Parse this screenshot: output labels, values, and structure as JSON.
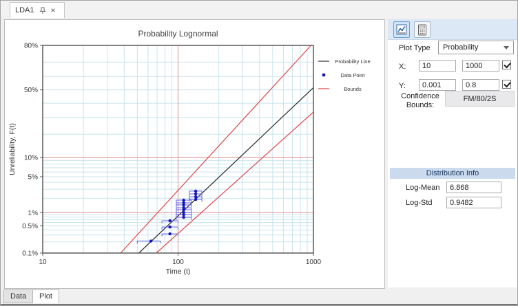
{
  "icons": {
    "close": "×"
  },
  "doc_tab": {
    "title": "LDA1"
  },
  "sidebar": {
    "plot_type": {
      "label": "Plot Type",
      "value": "Probability"
    },
    "x_range": {
      "label": "X:",
      "min": "10",
      "max": "1000",
      "checked": true
    },
    "y_range": {
      "label": "Y:",
      "min": "0.001",
      "max": "0.8",
      "checked": true
    },
    "confidence_bounds": {
      "label": "Confidence Bounds:",
      "value": "FM/80/2S"
    },
    "distribution_info": {
      "header": "Distribution Info",
      "fields": [
        {
          "label": "Log-Mean",
          "value": "6.868"
        },
        {
          "label": "Log-Std",
          "value": "0.9482"
        }
      ]
    }
  },
  "bottom_tabs": [
    {
      "label": "Data",
      "active": false
    },
    {
      "label": "Plot",
      "active": true
    }
  ],
  "chart_data": {
    "type": "line",
    "title": "Probability Lognormal",
    "xlabel": "Time (t)",
    "ylabel": "Unreliability, F(t)",
    "x_scale": "log10",
    "y_scale": "normal-probit",
    "xlim": [
      10,
      1000
    ],
    "ylim_pct": [
      0.1,
      80
    ],
    "x_ticks": [
      {
        "t": 10,
        "label": "10"
      },
      {
        "t": 100,
        "label": "100"
      },
      {
        "t": 1000,
        "label": "1000"
      }
    ],
    "y_ticks": [
      {
        "pct": 80,
        "label": "80%"
      },
      {
        "pct": 50,
        "label": "50%"
      },
      {
        "pct": 10,
        "label": "10%"
      },
      {
        "pct": 5,
        "label": "5%"
      },
      {
        "pct": 1,
        "label": "1%"
      },
      {
        "pct": 0.5,
        "label": "0.5%"
      },
      {
        "pct": 0.1,
        "label": "0.1%"
      }
    ],
    "x_major": [
      100
    ],
    "y_major_pct": [
      10,
      1
    ],
    "x_minor": [
      20,
      30,
      40,
      50,
      60,
      70,
      80,
      90,
      200,
      300,
      400,
      500,
      600,
      700,
      800,
      900
    ],
    "y_minor_pct": [
      70,
      60,
      50,
      40,
      30,
      20,
      9,
      8,
      7,
      6,
      5,
      4,
      3,
      2,
      0.9,
      0.8,
      0.7,
      0.6,
      0.5,
      0.4,
      0.3,
      0.2
    ],
    "legend": [
      "Probability Line",
      "Data Point",
      "Bounds"
    ],
    "fit": {
      "distribution": "Lognormal",
      "log_mean": 6.868,
      "log_std": 0.9482
    },
    "bounds": {
      "type": "FM/80/2S",
      "upper": {
        "t": [
          37.6,
          960
        ],
        "p_pct": [
          0.1,
          80
        ]
      },
      "lower": {
        "t": [
          69,
          1000
        ],
        "p_pct": [
          0.1,
          33.7
        ]
      }
    },
    "groups": [
      {
        "t": 63,
        "t_lo": 50,
        "t_hi": 74,
        "F_pct": [
          0.21
        ]
      },
      {
        "t": 87,
        "t_lo": 76,
        "t_hi": 100,
        "F_pct": [
          0.32,
          0.47,
          0.66
        ]
      },
      {
        "t": 110,
        "t_lo": 97,
        "t_hi": 125,
        "F_pct": [
          0.79,
          0.91,
          1.01,
          1.16,
          1.28,
          1.47,
          1.62,
          1.84
        ]
      },
      {
        "t": 135,
        "t_lo": 121,
        "t_hi": 150,
        "F_pct": [
          1.9,
          2.15,
          2.44,
          2.76
        ]
      }
    ],
    "colors": {
      "grid_minor": "#c8e4ef",
      "grid_major": "#e09a9a",
      "frame": "#5a5a5a",
      "line": "#333333",
      "bounds": "#e04545",
      "point": "#1515c0",
      "bracket": "#5c5ce0"
    }
  }
}
